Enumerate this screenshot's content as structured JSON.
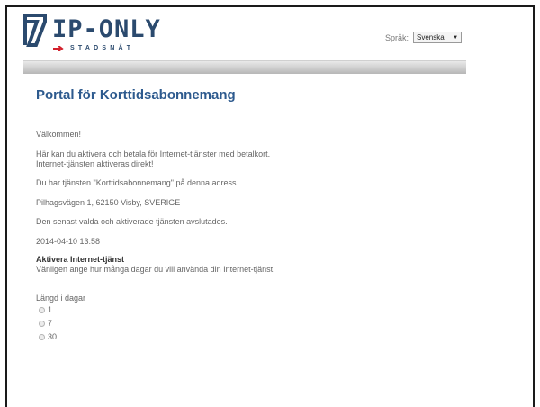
{
  "header": {
    "logo_text": "IP-ONLY",
    "logo_subtext": "STADSNÄT",
    "language_label": "Språk:",
    "language_selected": "Svenska"
  },
  "main": {
    "title": "Portal för Korttidsabonnemang",
    "welcome": "Välkommen!",
    "intro_line1": "Här kan du aktivera och betala för Internet-tjänster med betalkort.",
    "intro_line2": "Internet-tjänsten aktiveras direkt!",
    "service_notice": "Du har tjänsten \"Korttidsabonnemang\" på denna adress.",
    "address": "Pilhagsvägen 1, 62150 Visby, SVERIGE",
    "ended_notice": "Den senast valda och aktiverade tjänsten avslutades.",
    "timestamp": "2014-04-10 13:58",
    "activate_heading": "Aktivera Internet-tjänst",
    "activate_text": "Vänligen ange hur många dagar du vill använda din Internet-tjänst.",
    "days_label": "Längd i dagar",
    "day_options": [
      "1",
      "7",
      "30"
    ]
  },
  "colors": {
    "title": "#2d5a8e",
    "logo": "#2b4a6e",
    "logo_accent": "#d21f2b"
  },
  "icons": {
    "logo_mark": "ip-only-logo-icon",
    "dropdown": "chevron-down-icon"
  }
}
